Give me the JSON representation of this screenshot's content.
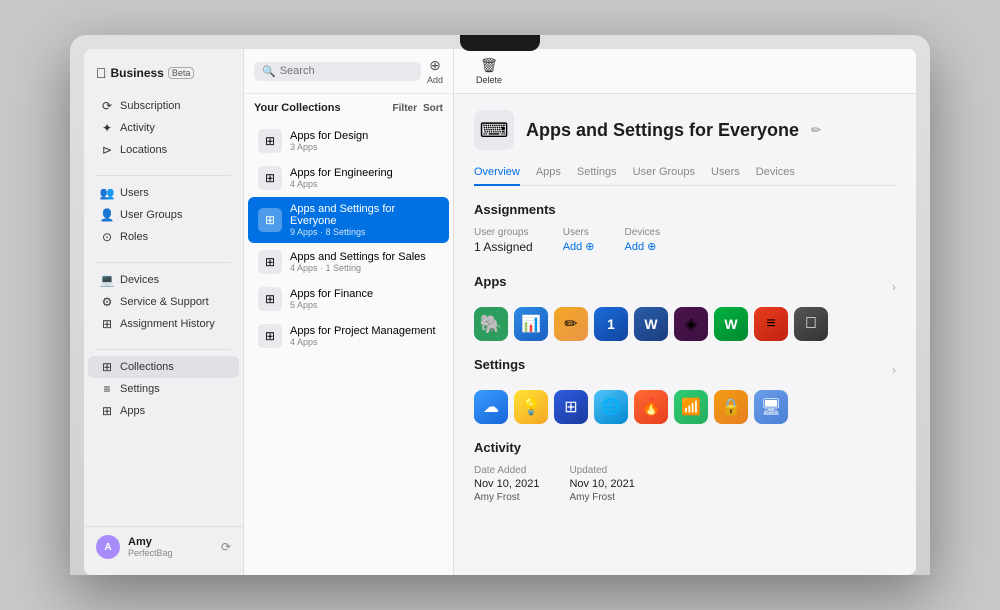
{
  "brand": {
    "name": "Business",
    "beta": "Beta"
  },
  "sidebar": {
    "items": [
      {
        "id": "subscription",
        "label": "Subscription",
        "icon": "⟳"
      },
      {
        "id": "activity",
        "label": "Activity",
        "icon": "✦"
      },
      {
        "id": "locations",
        "label": "Locations",
        "icon": "⊳"
      },
      {
        "id": "users",
        "label": "Users",
        "icon": "👥"
      },
      {
        "id": "user-groups",
        "label": "User Groups",
        "icon": "👤"
      },
      {
        "id": "roles",
        "label": "Roles",
        "icon": "⊙"
      },
      {
        "id": "devices",
        "label": "Devices",
        "icon": "💻"
      },
      {
        "id": "service-support",
        "label": "Service & Support",
        "icon": "⚙"
      },
      {
        "id": "assignment-history",
        "label": "Assignment History",
        "icon": "⊞"
      },
      {
        "id": "collections",
        "label": "Collections",
        "icon": "⊞",
        "active": true
      },
      {
        "id": "settings",
        "label": "Settings",
        "icon": "≡"
      },
      {
        "id": "apps",
        "label": "Apps",
        "icon": "⊞"
      }
    ],
    "user": {
      "name": "Amy",
      "org": "PerfectBag",
      "initials": "A"
    }
  },
  "search": {
    "placeholder": "Search"
  },
  "toolbar": {
    "add_label": "Add",
    "delete_label": "Delete"
  },
  "collections_panel": {
    "title": "Your Collections",
    "filter_label": "Filter",
    "sort_label": "Sort",
    "items": [
      {
        "id": "design",
        "name": "Apps for Design",
        "meta": "3 Apps"
      },
      {
        "id": "engineering",
        "name": "Apps for Engineering",
        "meta": "4 Apps"
      },
      {
        "id": "everyone",
        "name": "Apps and Settings for Everyone",
        "meta": "9 Apps · 8 Settings",
        "selected": true
      },
      {
        "id": "sales",
        "name": "Apps and Settings for Sales",
        "meta": "4 Apps · 1 Setting"
      },
      {
        "id": "finance",
        "name": "Apps for Finance",
        "meta": "5 Apps"
      },
      {
        "id": "project-management",
        "name": "Apps for Project Management",
        "meta": "4 Apps"
      }
    ]
  },
  "detail": {
    "title": "Apps and Settings for Everyone",
    "tabs": [
      {
        "id": "overview",
        "label": "Overview",
        "active": true
      },
      {
        "id": "apps",
        "label": "Apps"
      },
      {
        "id": "settings",
        "label": "Settings"
      },
      {
        "id": "user-groups",
        "label": "User Groups"
      },
      {
        "id": "users",
        "label": "Users"
      },
      {
        "id": "devices",
        "label": "Devices"
      }
    ],
    "assignments": {
      "user_groups_label": "User groups",
      "user_groups_value": "1 Assigned",
      "users_label": "Users",
      "users_add": "Add",
      "devices_label": "Devices",
      "devices_add": "Add"
    },
    "apps_section": {
      "title": "Apps",
      "icons": [
        {
          "id": "evernote",
          "emoji": "🐘",
          "color": "app-icon-green"
        },
        {
          "id": "keynote",
          "emoji": "📊",
          "color": "app-icon-blue"
        },
        {
          "id": "pages",
          "emoji": "📝",
          "color": "app-icon-orange"
        },
        {
          "id": "1password",
          "emoji": "🔵",
          "color": "app-icon-darkblue"
        },
        {
          "id": "word",
          "emoji": "W",
          "color": "app-icon-purple"
        },
        {
          "id": "slack",
          "emoji": "◈",
          "color": "app-icon-yellow"
        },
        {
          "id": "webex",
          "emoji": "Ⓦ",
          "color": "app-icon-red"
        },
        {
          "id": "another",
          "emoji": "≡",
          "color": "app-icon-red"
        },
        {
          "id": "apple",
          "emoji": "",
          "color": "app-icon-gray"
        }
      ]
    },
    "settings_section": {
      "title": "Settings",
      "icons": [
        {
          "id": "icloud",
          "emoji": "☁",
          "color": "setting-icon-blue"
        },
        {
          "id": "bulb",
          "emoji": "💡",
          "color": "setting-icon-yellow"
        },
        {
          "id": "screentime",
          "emoji": "⊞",
          "color": "setting-icon-darkblue"
        },
        {
          "id": "globe",
          "emoji": "🌐",
          "color": "setting-icon-globe"
        },
        {
          "id": "flame",
          "emoji": "🔥",
          "color": "setting-icon-red"
        },
        {
          "id": "wifi",
          "emoji": "📶",
          "color": "setting-icon-wifi"
        },
        {
          "id": "lock",
          "emoji": "🔒",
          "color": "setting-icon-lock"
        },
        {
          "id": "display",
          "emoji": "🖥",
          "color": "setting-icon-display"
        }
      ]
    },
    "activity": {
      "title": "Activity",
      "date_added_label": "Date Added",
      "date_added_value": "Nov 10, 2021",
      "date_added_by": "Amy Frost",
      "updated_label": "Updated",
      "updated_value": "Nov 10, 2021",
      "updated_by": "Amy Frost"
    }
  }
}
